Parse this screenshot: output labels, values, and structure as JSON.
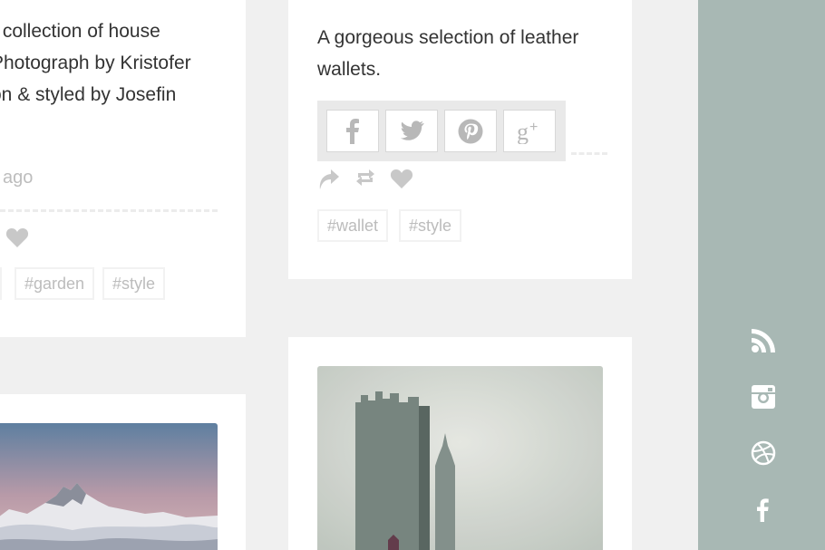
{
  "posts": {
    "left_top": {
      "text": "r collection of house\nPhotograph by Kristofer\non & styled by Josefin",
      "timestamp": "ago",
      "tags": [
        "#garden",
        "#style"
      ]
    },
    "right_top": {
      "text": "A gorgeous selection of leather wallets.",
      "share_buttons": [
        {
          "icon": "facebook-icon"
        },
        {
          "icon": "twitter-icon"
        },
        {
          "icon": "pinterest-icon"
        },
        {
          "icon": "google-plus-icon"
        }
      ],
      "actions": [
        {
          "icon": "share-arrow-icon"
        },
        {
          "icon": "reblog-icon"
        },
        {
          "icon": "heart-icon"
        }
      ],
      "tags": [
        "#wallet",
        "#style"
      ]
    },
    "left_bottom": {
      "image": "mountain-photo"
    },
    "right_bottom": {
      "image": "city-skyscraper-photo"
    }
  },
  "sidebar": {
    "background": "#a8b8b4",
    "social_icons": [
      {
        "icon": "rss-icon"
      },
      {
        "icon": "instagram-icon"
      },
      {
        "icon": "dribbble-icon"
      },
      {
        "icon": "facebook-icon"
      }
    ]
  },
  "colors": {
    "page_background": "#f0f0f0",
    "card_background": "#ffffff",
    "muted_icon": "#c8c8c8",
    "tag_text": "#bcbcbc"
  }
}
